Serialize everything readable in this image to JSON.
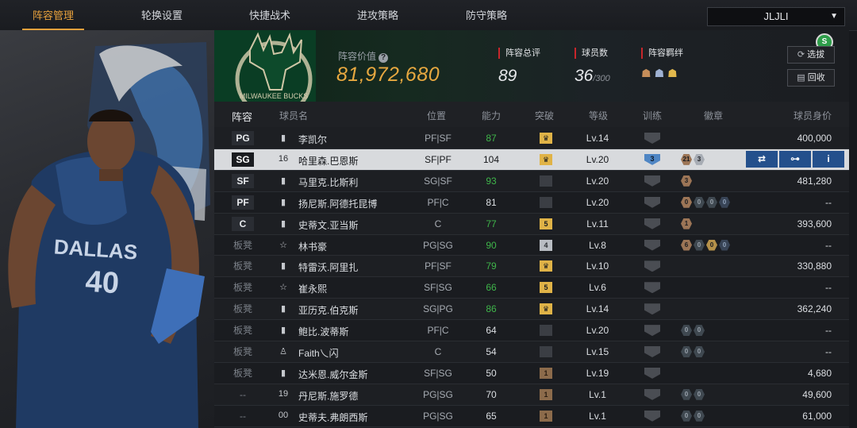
{
  "tabs": [
    "阵容管理",
    "轮换设置",
    "快捷战术",
    "进攻策略",
    "防守策略"
  ],
  "active_tab": 0,
  "team_select": "JLJLI",
  "player_art": {
    "jersey_team": "DALLAS",
    "jersey_number": "40"
  },
  "logo_text": "MILWAUKEE BUCKS",
  "lineup_value": {
    "label": "阵容价值",
    "help_icon": "?",
    "value": "81,972,680"
  },
  "stats": {
    "rating": {
      "label": "阵容总评",
      "value": "89"
    },
    "players": {
      "label": "球员数",
      "value": "36",
      "max": "/300"
    },
    "bond": {
      "label": "阵容羁绊"
    }
  },
  "buttons": {
    "select": "选拔",
    "recycle": "回收"
  },
  "columns": {
    "pos": "阵容",
    "name": "球员名",
    "role": "位置",
    "rating": "能力",
    "breakthrough": "突破",
    "level": "等级",
    "training": "训练",
    "badges": "徽章",
    "price": "球员身价"
  },
  "rows": [
    {
      "pos": "PG",
      "icon": "signal",
      "name": "李凯尔",
      "role": "PF|SF",
      "rating": "87",
      "green": true,
      "brk": {
        "type": "gold",
        "text": "♛"
      },
      "level": "Lv.14",
      "train": "",
      "badges": [],
      "price": "400,000"
    },
    {
      "pos": "SG",
      "icon": "16",
      "name": "哈里森.巴恩斯",
      "role": "SF|PF",
      "rating": "104",
      "green": false,
      "brk": {
        "type": "gold",
        "text": "♛"
      },
      "level": "Lv.20",
      "train": "3",
      "badges": [
        {
          "t": "br",
          "v": "21"
        },
        {
          "t": "sv",
          "v": "3"
        }
      ],
      "price": "",
      "selected": true
    },
    {
      "pos": "SF",
      "icon": "signal",
      "name": "马里克.比斯利",
      "role": "SG|SF",
      "rating": "93",
      "green": true,
      "brk": {
        "type": "",
        "text": ""
      },
      "level": "Lv.20",
      "train": "",
      "badges": [
        {
          "t": "br",
          "v": "3"
        }
      ],
      "price": "481,280"
    },
    {
      "pos": "PF",
      "icon": "signal",
      "name": "扬尼斯.阿德托昆博",
      "role": "PF|C",
      "rating": "81",
      "green": false,
      "brk": {
        "type": "",
        "text": ""
      },
      "level": "Lv.20",
      "train": "",
      "badges": [
        {
          "t": "br",
          "v": "0"
        },
        {
          "t": "em",
          "v": "0"
        },
        {
          "t": "em",
          "v": "0"
        },
        {
          "t": "db",
          "v": "0"
        }
      ],
      "price": "--"
    },
    {
      "pos": "C",
      "icon": "signal",
      "name": "史蒂文.亚当斯",
      "role": "C",
      "rating": "77",
      "green": true,
      "brk": {
        "type": "gold",
        "text": "5"
      },
      "level": "Lv.11",
      "train": "",
      "badges": [
        {
          "t": "br",
          "v": "1"
        }
      ],
      "price": "393,600"
    },
    {
      "pos": "板凳",
      "icon": "star",
      "name": "林书豪",
      "role": "PG|SG",
      "rating": "90",
      "green": true,
      "brk": {
        "type": "silver",
        "text": "4"
      },
      "level": "Lv.8",
      "train": "",
      "badges": [
        {
          "t": "br",
          "v": "6"
        },
        {
          "t": "em",
          "v": "0"
        },
        {
          "t": "gd",
          "v": "0"
        },
        {
          "t": "db",
          "v": "0"
        }
      ],
      "price": "--"
    },
    {
      "pos": "板凳",
      "icon": "signal",
      "name": "特雷沃.阿里扎",
      "role": "PF|SF",
      "rating": "79",
      "green": true,
      "brk": {
        "type": "gold",
        "text": "♛"
      },
      "level": "Lv.10",
      "train": "",
      "badges": [],
      "price": "330,880"
    },
    {
      "pos": "板凳",
      "icon": "star",
      "name": "崔永熙",
      "role": "SF|SG",
      "rating": "66",
      "green": true,
      "brk": {
        "type": "gold",
        "text": "5"
      },
      "level": "Lv.6",
      "train": "",
      "badges": [],
      "price": "--"
    },
    {
      "pos": "板凳",
      "icon": "signal",
      "name": "亚历克.伯克斯",
      "role": "SG|PG",
      "rating": "86",
      "green": true,
      "brk": {
        "type": "gold",
        "text": "♛"
      },
      "level": "Lv.14",
      "train": "",
      "badges": [],
      "price": "362,240"
    },
    {
      "pos": "板凳",
      "icon": "signal",
      "name": "鲍比.波蒂斯",
      "role": "PF|C",
      "rating": "64",
      "green": false,
      "brk": {
        "type": "",
        "text": ""
      },
      "level": "Lv.20",
      "train": "",
      "badges": [
        {
          "t": "em",
          "v": "0"
        },
        {
          "t": "em",
          "v": "0"
        }
      ],
      "price": "--"
    },
    {
      "pos": "板凳",
      "icon": "person",
      "name": "Faith乀闪",
      "role": "C",
      "rating": "54",
      "green": false,
      "brk": {
        "type": "",
        "text": ""
      },
      "level": "Lv.15",
      "train": "",
      "badges": [
        {
          "t": "em",
          "v": "0"
        },
        {
          "t": "em",
          "v": "0"
        }
      ],
      "price": "--"
    },
    {
      "pos": "板凳",
      "icon": "signal",
      "name": "达米恩.威尔金斯",
      "role": "SF|SG",
      "rating": "50",
      "green": false,
      "brk": {
        "type": "bronze",
        "text": "1"
      },
      "level": "Lv.19",
      "train": "",
      "badges": [],
      "price": "4,680"
    },
    {
      "pos": "--",
      "icon": "19",
      "name": "丹尼斯.施罗德",
      "role": "PG|SG",
      "rating": "70",
      "green": false,
      "brk": {
        "type": "bronze",
        "text": "1"
      },
      "level": "Lv.1",
      "train": "",
      "badges": [
        {
          "t": "em",
          "v": "0"
        },
        {
          "t": "em",
          "v": "0"
        }
      ],
      "price": "49,600"
    },
    {
      "pos": "--",
      "icon": "00",
      "name": "史蒂夫.弗朗西斯",
      "role": "PG|SG",
      "rating": "65",
      "green": false,
      "brk": {
        "type": "bronze",
        "text": "1"
      },
      "level": "Lv.1",
      "train": "",
      "badges": [
        {
          "t": "em",
          "v": "0"
        },
        {
          "t": "em",
          "v": "0"
        }
      ],
      "price": "61,000"
    }
  ],
  "row_actions": {
    "swap": "⇄",
    "train": "⊶",
    "info": "i"
  }
}
